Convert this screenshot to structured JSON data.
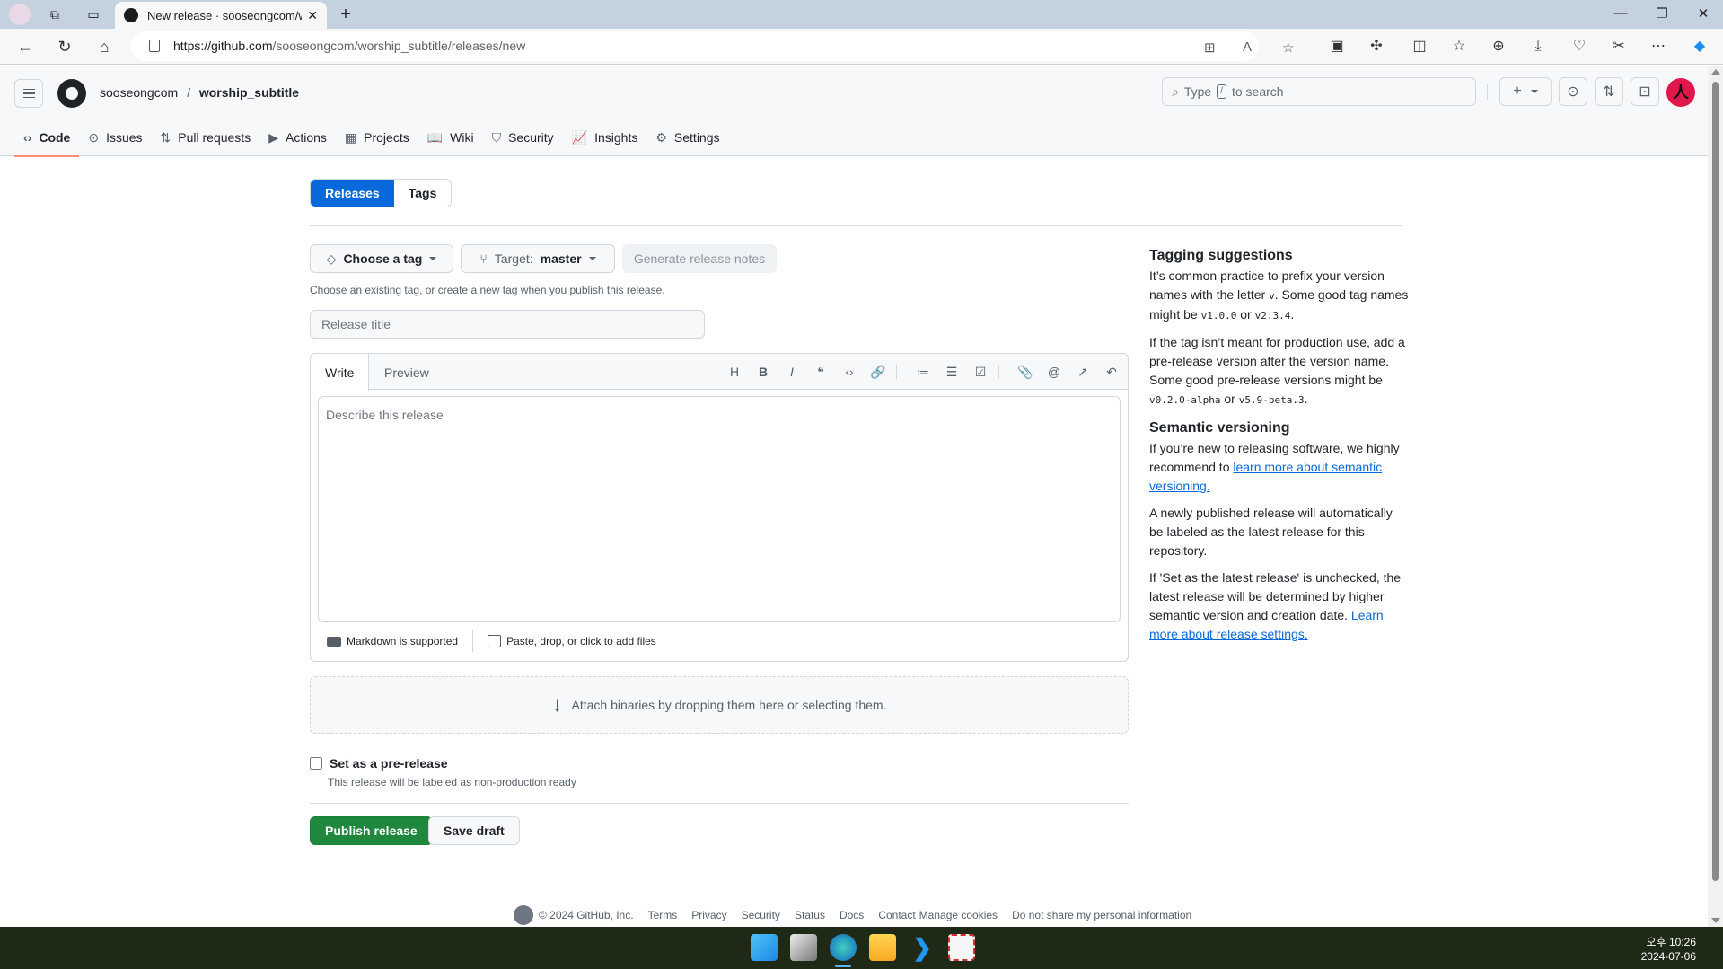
{
  "browser": {
    "tab_title": "New release · sooseongcom/worship_subtitle",
    "url_host": "https://github.com",
    "url_path": "/sooseongcom/worship_subtitle/releases/new",
    "new_tab_label": "+",
    "window": {
      "minimize": "—",
      "restore": "❐",
      "close": "✕"
    }
  },
  "header": {
    "owner": "sooseongcom",
    "separator": "/",
    "repo": "worship_subtitle",
    "search_prefix": "Type",
    "search_key": "/",
    "search_suffix": "to search",
    "avatar_glyph": "人"
  },
  "repo_nav": [
    {
      "label": "Code",
      "icon": "‹›",
      "active": true
    },
    {
      "label": "Issues",
      "icon": "⊙"
    },
    {
      "label": "Pull requests",
      "icon": "⇅"
    },
    {
      "label": "Actions",
      "icon": "▶"
    },
    {
      "label": "Projects",
      "icon": "▦"
    },
    {
      "label": "Wiki",
      "icon": "📖"
    },
    {
      "label": "Security",
      "icon": "⛉"
    },
    {
      "label": "Insights",
      "icon": "📈"
    },
    {
      "label": "Settings",
      "icon": "⚙"
    }
  ],
  "subnav": {
    "releases": "Releases",
    "tags": "Tags"
  },
  "form": {
    "choose_tag": "Choose a tag",
    "target_label": "Target:",
    "target_value": "master",
    "generate_notes": "Generate release notes",
    "tag_hint": "Choose an existing tag, or create a new tag when you publish this release.",
    "title_placeholder": "Release title",
    "write_tab": "Write",
    "preview_tab": "Preview",
    "desc_placeholder": "Describe this release",
    "markdown_supported": "Markdown is supported",
    "add_files": "Paste, drop, or click to add files",
    "attach_binaries": "Attach binaries by dropping them here or selecting them.",
    "prerelease_label": "Set as a pre-release",
    "prerelease_checked": false,
    "prerelease_hint": "This release will be labeled as non-production ready",
    "publish": "Publish release",
    "save_draft": "Save draft"
  },
  "toolbar": [
    {
      "name": "heading",
      "glyph": "H"
    },
    {
      "name": "bold",
      "glyph": "B"
    },
    {
      "name": "italic",
      "glyph": "I"
    },
    {
      "name": "quote",
      "glyph": "❝"
    },
    {
      "name": "code",
      "glyph": "‹›"
    },
    {
      "name": "link",
      "glyph": "🔗"
    },
    {
      "name": "numbered-list",
      "glyph": "≔"
    },
    {
      "name": "unordered-list",
      "glyph": "☰"
    },
    {
      "name": "task-list",
      "glyph": "☑"
    },
    {
      "name": "attach",
      "glyph": "📎"
    },
    {
      "name": "mention",
      "glyph": "@"
    },
    {
      "name": "reference",
      "glyph": "↗"
    },
    {
      "name": "undo",
      "glyph": "↶"
    }
  ],
  "aside": {
    "h1": "Tagging suggestions",
    "p1a": "It’s common practice to prefix your version names with the letter ",
    "p1_code_v": "v",
    "p1b": ". Some good tag names might be ",
    "p1_code1": "v1.0.0",
    "p1c": " or ",
    "p1_code2": "v2.3.4",
    "p1d": ".",
    "p2a": "If the tag isn’t meant for production use, add a pre-release version after the version name. Some good pre-release versions might be ",
    "p2_code1": "v0.2.0-alpha",
    "p2b": " or ",
    "p2_code2": "v5.9-beta.3",
    "p2c": ".",
    "h2": "Semantic versioning",
    "p3a": "If you’re new to releasing software, we highly recommend to ",
    "p3_link": "learn more about semantic versioning.",
    "p4": "A newly published release will automatically be labeled as the latest release for this repository.",
    "p5a": "If 'Set as the latest release' is unchecked, the latest release will be determined by higher semantic version and creation date. ",
    "p5_link": "Learn more about release settings."
  },
  "footer": [
    "© 2024 GitHub, Inc.",
    "Terms",
    "Privacy",
    "Security",
    "Status",
    "Docs",
    "Contact",
    "Manage cookies",
    "Do not share my personal information"
  ],
  "taskbar": {
    "time": "오후 10:26",
    "date": "2024-07-06"
  }
}
